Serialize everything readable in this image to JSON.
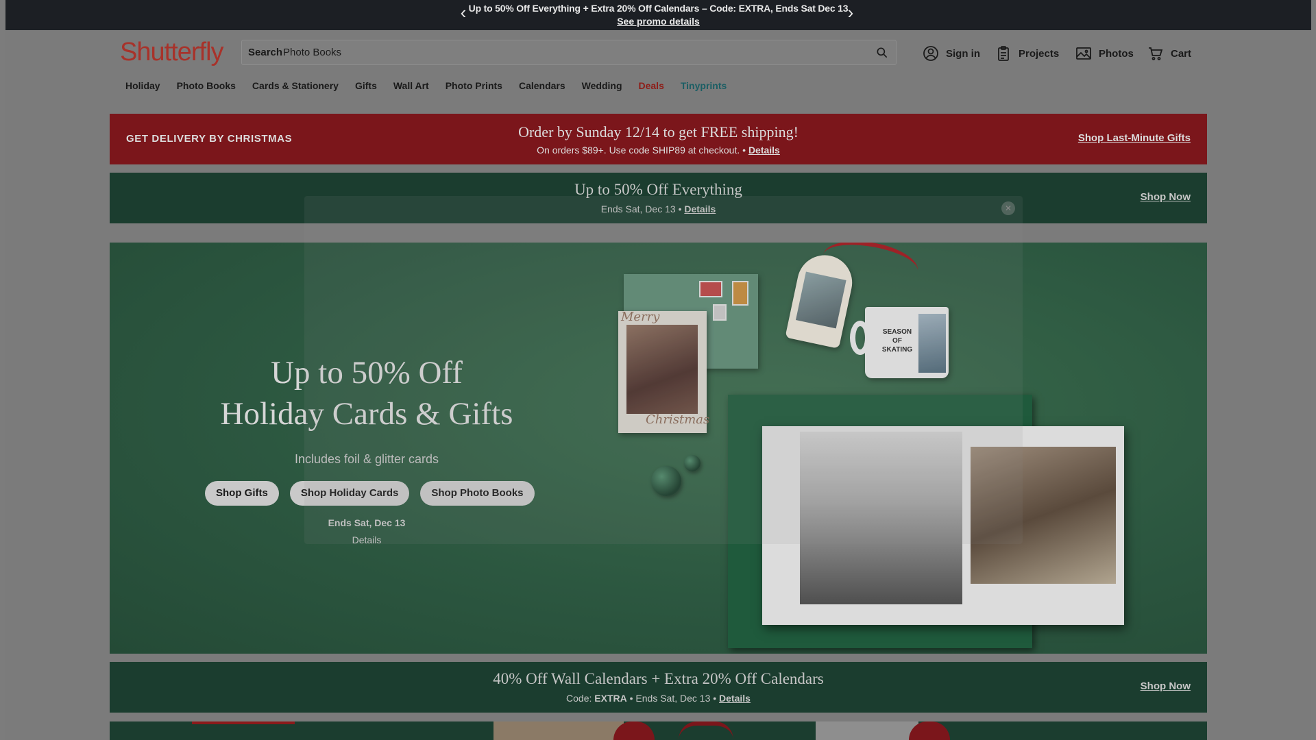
{
  "promo_bar": {
    "text": "Up to 50% Off Everything + Extra 20% Off Calendars – Code: EXTRA, Ends Sat Dec 13",
    "link": "See promo details"
  },
  "header": {
    "logo": "Shutterfly",
    "search": {
      "label": "Search",
      "value": "Photo Books"
    },
    "sign_in": "Sign in",
    "projects": "Projects",
    "photos": "Photos",
    "cart": "Cart"
  },
  "nav": {
    "items": [
      "Holiday",
      "Photo Books",
      "Cards & Stationery",
      "Gifts",
      "Wall Art",
      "Photo Prints",
      "Calendars",
      "Wedding",
      "Deals",
      "Tinyprints"
    ]
  },
  "red_banner": {
    "left_label": "GET DELIVERY BY CHRISTMAS",
    "headline": "Order by Sunday 12/14 to get FREE shipping!",
    "sub_text": "On orders $89+. Use code SHIP89 at checkout.",
    "sub_link": "Details",
    "cta": "Shop Last-Minute Gifts"
  },
  "green_banner": {
    "headline": "Up to 50% Off Everything",
    "sub_text": "Ends Sat, Dec 13",
    "sub_link": "Details",
    "cta": "Shop Now"
  },
  "hero": {
    "title_line1": "Up to 50% Off",
    "title_line2": "Holiday Cards & Gifts",
    "subtitle": "Includes foil & glitter cards",
    "buttons": [
      "Shop Gifts",
      "Shop Holiday Cards",
      "Shop Photo Books"
    ],
    "ends": "Ends Sat, Dec 13",
    "details": "Details",
    "card_script_top": "Merry",
    "card_script_bottom": "Christmas",
    "mug_text": "SEASON OF SKATING"
  },
  "green_banner_2": {
    "headline": "40% Off Wall Calendars + Extra 20% Off Calendars",
    "code_label": "Code:",
    "code": "EXTRA",
    "ends": "Ends Sat, Dec 13",
    "sub_link": "Details",
    "cta": "Shop Now"
  },
  "colors": {
    "promo_bar_bg": "#1c1f24",
    "brand_red": "#a8322a",
    "red_banner_bg": "#7b161b",
    "green_banner_bg": "#1b3d2f",
    "hero_bg": "#2e5a3f",
    "deals_color": "#8e1d18",
    "tinyprints_color": "#1b5e64"
  }
}
